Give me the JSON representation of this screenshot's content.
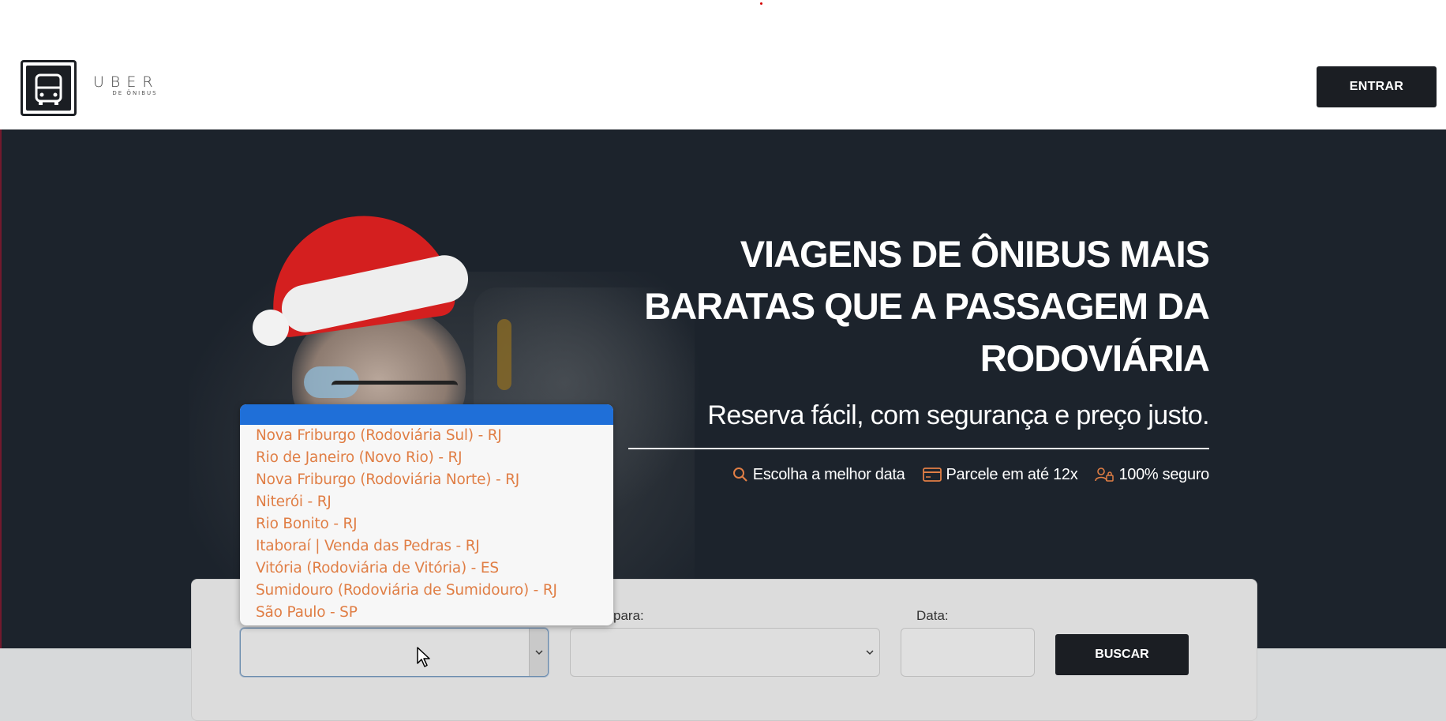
{
  "header": {
    "brand_name": "UBER",
    "brand_sub": "DE ÔNIBUS",
    "login_button": "ENTRAR"
  },
  "hero": {
    "title": "VIAGENS DE ÔNIBUS MAIS BARATAS QUE A PASSAGEM DA RODOVIÁRIA",
    "subtitle": "Reserva fácil, com segurança e preço justo.",
    "features": [
      {
        "icon": "search-icon",
        "label": "Escolha a melhor data"
      },
      {
        "icon": "credit-card-icon",
        "label": "Parcele em até 12x"
      },
      {
        "icon": "user-lock-icon",
        "label": "100% seguro"
      }
    ]
  },
  "colors": {
    "dark": "#1b1e23",
    "hero_bg": "#1c232c",
    "accent": "#e07e45",
    "highlight": "#1f6fd8"
  },
  "search": {
    "destino_label": "para:",
    "data_label": "Data:",
    "origem_value": "",
    "destino_value": "",
    "data_value": "",
    "buscar_button": "BUSCAR"
  },
  "dropdown": {
    "options": [
      "Nova Friburgo (Rodoviária Sul) - RJ",
      "Rio de Janeiro (Novo Rio) - RJ",
      "Nova Friburgo (Rodoviária Norte) - RJ",
      "Niterói - RJ",
      "Rio Bonito - RJ",
      "Itaboraí | Venda das Pedras - RJ",
      "Vitória (Rodoviária de Vitória) - ES",
      "Sumidouro (Rodoviária de Sumidouro) - RJ",
      "São Paulo - SP"
    ]
  }
}
